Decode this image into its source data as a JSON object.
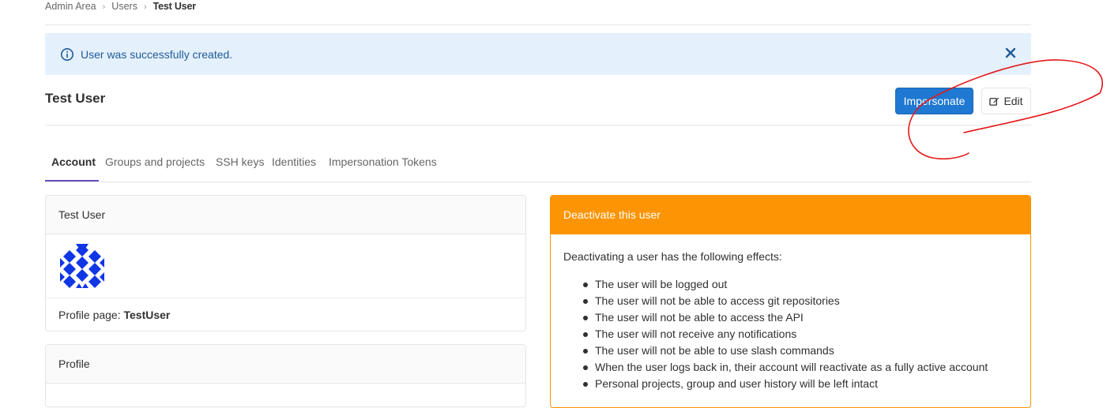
{
  "breadcrumb": {
    "items": [
      "Admin Area",
      "Users"
    ],
    "current": "Test User"
  },
  "alert": {
    "message": "User was successfully created.",
    "icon": "info-circle-icon",
    "close_icon": "close-icon"
  },
  "header": {
    "title": "Test User",
    "impersonate_label": "Impersonate",
    "edit_label": "Edit",
    "edit_icon": "pencil-square-icon"
  },
  "tabs": [
    {
      "label": "Account",
      "active": true
    },
    {
      "label": "Groups and projects",
      "active": false
    },
    {
      "label": "SSH keys",
      "active": false
    },
    {
      "label": "Identities",
      "active": false
    },
    {
      "label": "Impersonation Tokens",
      "active": false
    }
  ],
  "user_card": {
    "name": "Test User",
    "profile_label": "Profile page: ",
    "profile_value": "TestUser"
  },
  "profile_card": {
    "title": "Profile"
  },
  "deactivate_card": {
    "title": "Deactivate this user",
    "intro": "Deactivating a user has the following effects:",
    "effects": [
      "The user will be logged out",
      "The user will not be able to access git repositories",
      "The user will not be able to access the API",
      "The user will not receive any notifications",
      "The user will not be able to use slash commands",
      "When the user logs back in, their account will reactivate as a fully active account",
      "Personal projects, group and user history will be left intact"
    ]
  },
  "colors": {
    "primary": "#1f78d1",
    "warning": "#fc9403",
    "alert_bg": "#e4f0fb",
    "alert_text": "#1f5b99",
    "tab_active": "#6b4fbb",
    "annotation": "#e3191c"
  }
}
